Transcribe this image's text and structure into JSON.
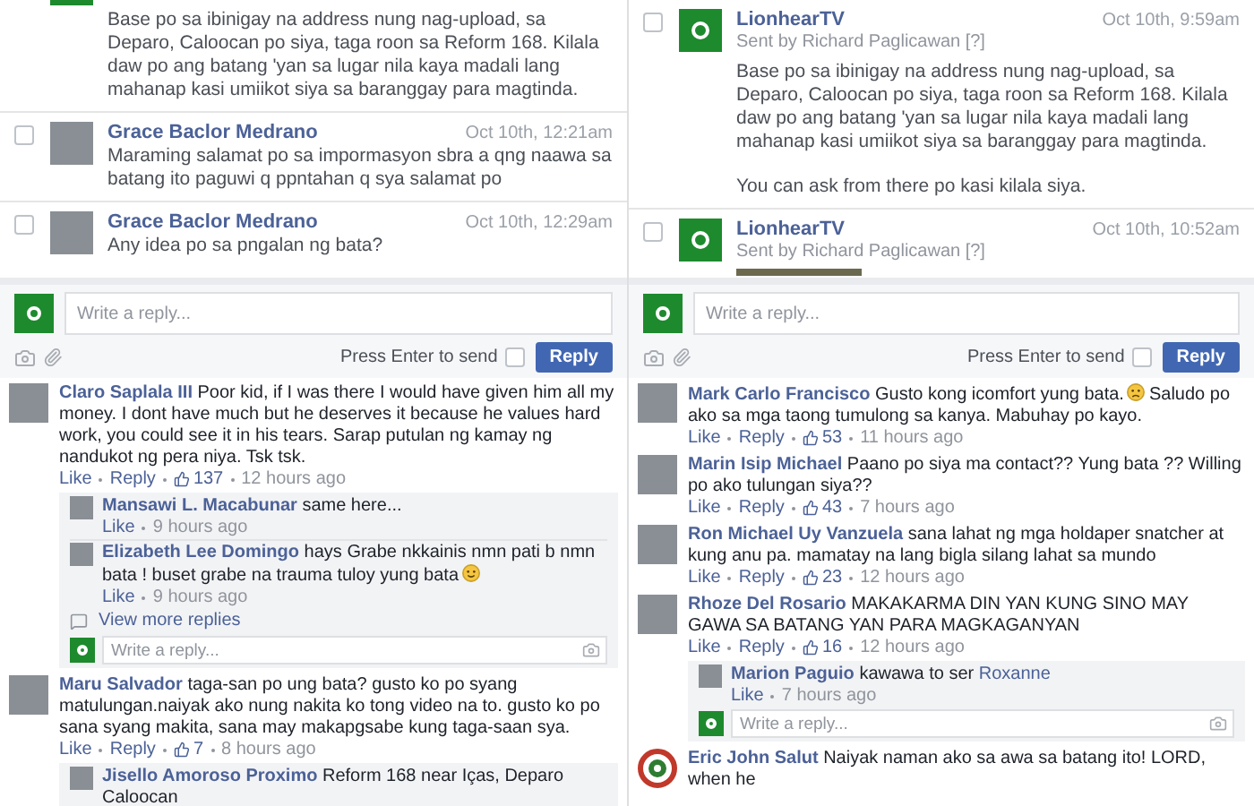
{
  "columns": [
    {
      "messages": [
        {
          "avatar": {
            "kind": "page"
          },
          "body": [
            "Base po sa ibinigay na address nung nag-upload, sa Deparo, Caloocan po siya, taga roon sa Reform 168. Kilala daw po ang batang 'yan sa lugar nila kaya madali lang mahanap kasi umiikot siya sa baranggay para magtinda."
          ]
        },
        {
          "checked": false,
          "avatar": {
            "kind": "photo"
          },
          "name": "Grace Baclor Medrano",
          "time": "Oct 10th, 12:21am",
          "body": [
            "Maraming salamat po sa impormasyon sbra a qng naawa sa batang ito paguwi q ppntahan q sya salamat po"
          ]
        },
        {
          "checked": false,
          "avatar": {
            "kind": "photo"
          },
          "name": "Grace Baclor Medrano",
          "time": "Oct 10th, 12:29am",
          "body": [
            "Any idea po sa pngalan ng bata?"
          ]
        }
      ],
      "composer": {
        "placeholder": "Write a reply...",
        "send_label": "Press Enter to send",
        "enter_to_send": false,
        "button": "Reply"
      },
      "comments": [
        {
          "avatar": {
            "kind": "photo"
          },
          "name": "Claro Saplala III",
          "text": "Poor kid, if I was there I would have given him all my money. I dont have much but he deserves it because he values hard work, you could see it in his tears. Sarap putulan ng kamay ng nandukot ng pera niya. Tsk tsk.",
          "like": "Like",
          "reply": "Reply",
          "likes": "137",
          "time": "12 hours ago",
          "replies": [
            {
              "name": "Mansawi L. Macabunar",
              "text": "same here...",
              "like": "Like",
              "time": "9 hours ago"
            },
            {
              "name": "Elizabeth Lee Domingo",
              "text": "hays Grabe nkkainis nmn pati b nmn bata ! buset grabe na trauma tuloy yung bata",
              "emoji": {
                "kind": "smile"
              },
              "like": "Like",
              "time": "9 hours ago"
            }
          ],
          "view_more": "View more replies",
          "reply_placeholder": "Write a reply..."
        },
        {
          "avatar": {
            "kind": "photo"
          },
          "name": "Maru Salvador",
          "text": "taga-san po ung bata? gusto ko po syang matulungan.naiyak ako nung nakita ko tong video na to. gusto ko po sana syang makita, sana may makapgsabe kung taga-saan sya.",
          "like": "Like",
          "reply": "Reply",
          "likes": "7",
          "time": "8 hours ago",
          "replies": [
            {
              "name": "Jisello Amoroso Proximo",
              "text": "Reform 168 near Iças, Deparo Caloocan"
            }
          ]
        }
      ]
    },
    {
      "messages": [
        {
          "checked": false,
          "avatar": {
            "kind": "page"
          },
          "name": "LionhearTV",
          "sender": "Sent by Richard Paglicawan [?]",
          "time": "Oct 10th, 9:59am",
          "body": [
            "Base po sa ibinigay na address nung nag-upload, sa Deparo, Caloocan po siya, taga roon sa Reform 168. Kilala daw po ang batang 'yan sa lugar nila kaya madali lang mahanap kasi umiikot siya sa baranggay para magtinda.",
            "You can ask from there po kasi kilala siya."
          ]
        },
        {
          "checked": false,
          "avatar": {
            "kind": "page"
          },
          "name": "LionhearTV",
          "sender": "Sent by Richard Paglicawan [?]",
          "time": "Oct 10th, 10:52am",
          "has_photo": true
        }
      ],
      "composer": {
        "placeholder": "Write a reply...",
        "send_label": "Press Enter to send",
        "enter_to_send": false,
        "button": "Reply"
      },
      "comments": [
        {
          "avatar": {
            "kind": "photo"
          },
          "name": "Mark Carlo Francisco",
          "text": "Gusto kong icomfort yung bata.",
          "emoji": {
            "kind": "frown"
          },
          "text_after": "Saludo po ako sa mga taong tumulong sa kanya. Mabuhay po kayo.",
          "like": "Like",
          "reply": "Reply",
          "likes": "53",
          "time": "11 hours ago"
        },
        {
          "avatar": {
            "kind": "photo"
          },
          "name": "Marin Isip Michael",
          "text": "Paano po siya ma contact?? Yung bata ?? Willing po ako tulungan siya??",
          "like": "Like",
          "reply": "Reply",
          "likes": "43",
          "time": "7 hours ago"
        },
        {
          "avatar": {
            "kind": "photo"
          },
          "name": "Ron Michael Uy Vanzuela",
          "text": "sana lahat ng mga holdaper snatcher at kung anu pa. mamatay na lang bigla silang lahat sa mundo",
          "like": "Like",
          "reply": "Reply",
          "likes": "23",
          "time": "12 hours ago"
        },
        {
          "avatar": {
            "kind": "photo"
          },
          "name": "Rhoze Del Rosario",
          "text": "MAKAKARMA DIN YAN KUNG SINO MAY GAWA SA BATANG YAN PARA MAGKAGANYAN",
          "like": "Like",
          "reply": "Reply",
          "likes": "16",
          "time": "12 hours ago",
          "replies": [
            {
              "name": "Marion Paguio",
              "text": "kawawa to ser",
              "mention": "Roxanne",
              "like": "Like",
              "time": "7 hours ago"
            }
          ],
          "reply_placeholder": "Write a reply..."
        },
        {
          "avatar": {
            "kind": "ring"
          },
          "name": "Eric John Salut",
          "text": "Naiyak naman ako sa awa sa batang ito! LORD, when he"
        }
      ]
    }
  ]
}
